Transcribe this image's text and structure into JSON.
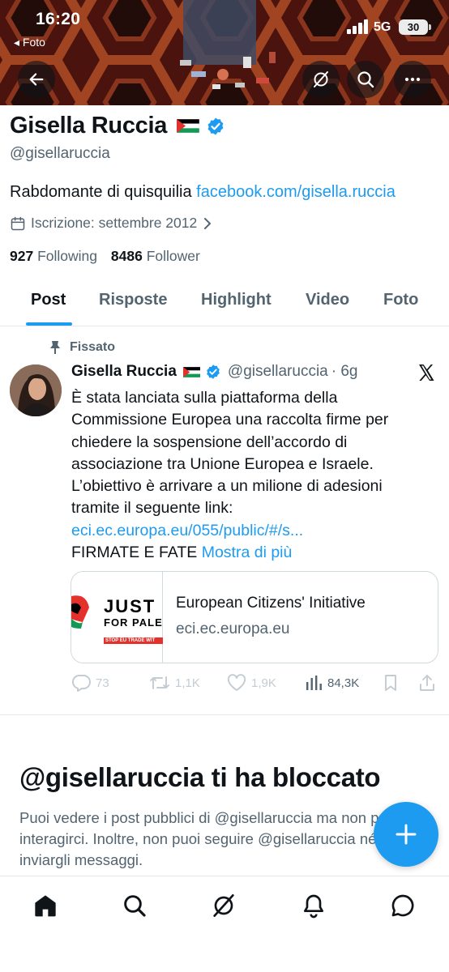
{
  "status_bar": {
    "time": "16:20",
    "back_app": "◂ Foto",
    "network": "5G",
    "battery": "30"
  },
  "header": {
    "icons": [
      "back-arrow-icon",
      "grok-icon",
      "search-icon",
      "more-icon"
    ]
  },
  "profile": {
    "name": "Gisella Ruccia",
    "handle": "@gisellaruccia",
    "bio_text": "Rabdomante di quisquilia ",
    "bio_link": "facebook.com/gisella.ruccia",
    "joined": "Iscrizione: settembre 2012",
    "following_count": "927",
    "following_label": "Following",
    "follower_count": "8486",
    "follower_label": "Follower"
  },
  "tabs": [
    {
      "label": "Post",
      "active": true
    },
    {
      "label": "Risposte",
      "active": false
    },
    {
      "label": "Highlight",
      "active": false
    },
    {
      "label": "Video",
      "active": false
    },
    {
      "label": "Foto",
      "active": false
    }
  ],
  "post": {
    "pinned_label": "Fissato",
    "author_name": "Gisella Ruccia",
    "author_handle": "@gisellaruccia",
    "time": "· 6g",
    "lines": [
      "È stata lanciata sulla piattaforma della",
      "Commissione Europea una raccolta firme per",
      "chiedere la sospensione dell’accordo di",
      "associazione tra Unione Europea e Israele.",
      "L’obiettivo è arrivare a un milione di adesioni",
      "tramite il seguente link:"
    ],
    "link": "eci.ec.europa.eu/055/public/#/s...",
    "last_text": "FIRMATE E FATE ",
    "show_more": "Mostra di più",
    "card": {
      "image_line1": "JUST",
      "image_line2": "FOR PALE",
      "image_line3": "STOP EU TRADE WIT",
      "title": "European Citizens' Initiative",
      "domain": "eci.ec.europa.eu"
    },
    "stats": {
      "replies": "73",
      "reposts": "1,1K",
      "likes": "1,9K",
      "views": "84,3K"
    }
  },
  "blocked": {
    "title": "@gisellaruccia ti ha bloccato",
    "lines": [
      "Puoi vedere i post pubblici di @gisellaruccia ma non puoi",
      "interagirci. Inoltre, non puoi seguire @gisellaruccia né",
      "inviargli messaggi."
    ]
  },
  "colors": {
    "accent": "#1d9bf0",
    "text": "#0f1419",
    "muted": "#536471"
  },
  "nav": {
    "items": [
      "home-icon",
      "search-icon",
      "grok-icon",
      "notifications-icon",
      "messages-icon"
    ]
  }
}
